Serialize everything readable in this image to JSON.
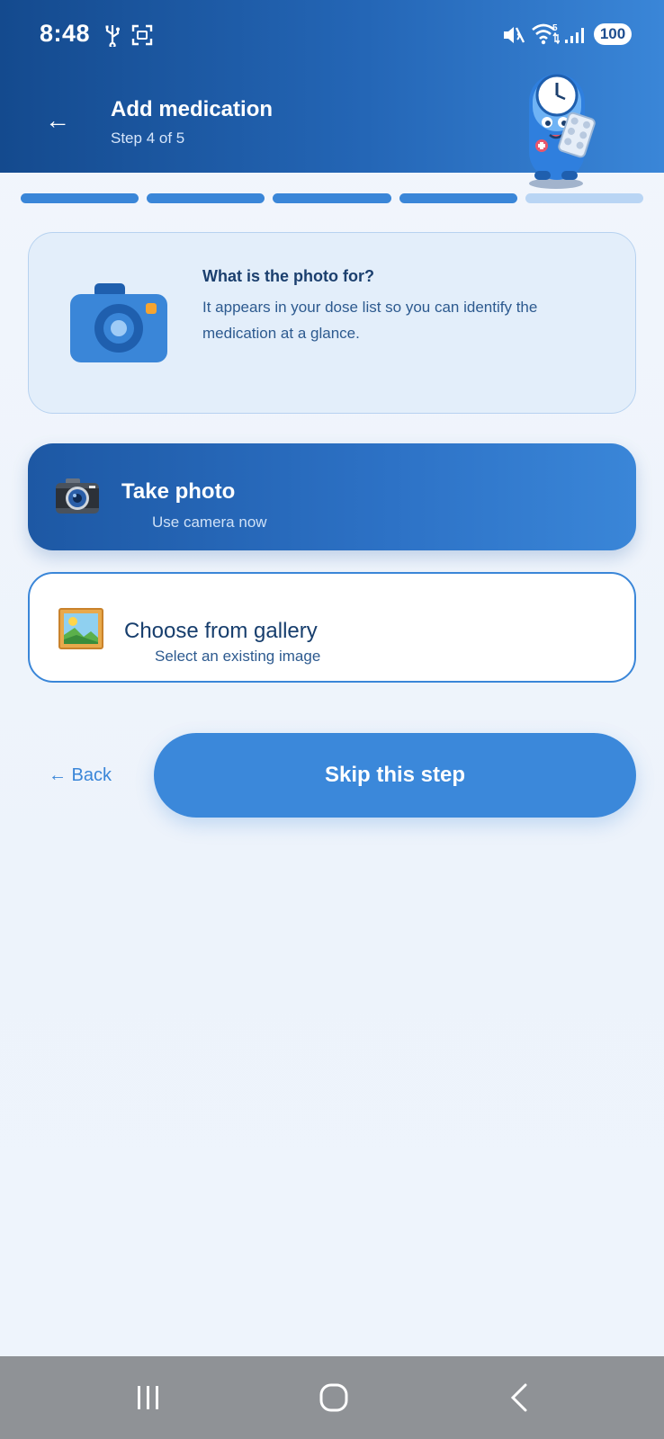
{
  "status_bar": {
    "time": "8:48",
    "battery": "100",
    "network_sup": "5",
    "icons": [
      "usb-icon",
      "screenshot-icon",
      "mute-icon",
      "wifi-icon",
      "signal-icon",
      "battery-icon"
    ]
  },
  "header": {
    "back_icon": "←",
    "title": "Add medication",
    "step": "Step 4 of 5"
  },
  "progress": {
    "current_step": 4,
    "total_steps": 5,
    "active_color": "#3a86d8",
    "inactive_color": "#b9d5f4"
  },
  "info_card": {
    "icon": "camera-icon",
    "title": "What is the photo for?",
    "description": "It appears in your dose list so you can identify the medication at a glance."
  },
  "take_photo": {
    "icon": "camera-icon",
    "title": "Take photo",
    "subtitle": "Use camera now"
  },
  "gallery": {
    "icon": "picture-icon",
    "title": "Choose from gallery",
    "subtitle": "Select an existing image"
  },
  "actions": {
    "back_label": "← Back",
    "skip_label": "Skip this step"
  },
  "colors": {
    "accent": "#3a86d8",
    "header_dark": "#144a8e"
  }
}
